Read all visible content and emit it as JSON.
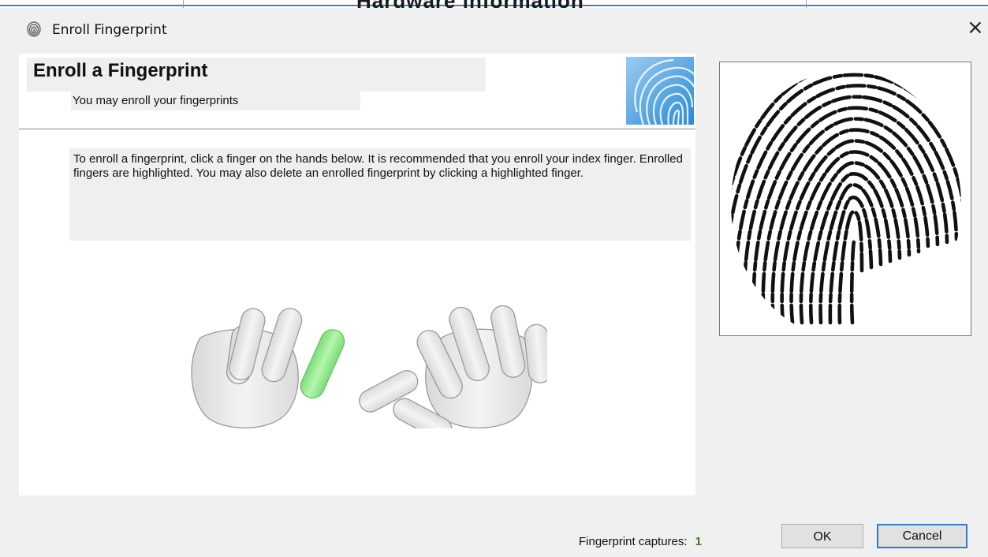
{
  "window": {
    "title": "Enroll Fingerprint",
    "behind_text": "Hardware information",
    "close_glyph": "×",
    "icons": {
      "app": "fingerprint-icon",
      "close": "close-icon"
    }
  },
  "header": {
    "title": "Enroll a Fingerprint",
    "subtitle": "You may enroll your fingerprints",
    "image": "fingerprint-banner-image"
  },
  "instructions": "To enroll a fingerprint, click a finger on the hands below.  It is recommended that you enroll your index finger.  Enrolled fingers are highlighted. You may also delete an enrolled fingerprint by clicking a highlighted finger.",
  "hands": {
    "left": [
      {
        "finger": "pinky",
        "enrolled": false
      },
      {
        "finger": "ring",
        "enrolled": false
      },
      {
        "finger": "middle",
        "enrolled": false
      },
      {
        "finger": "index",
        "enrolled": true
      },
      {
        "finger": "thumb",
        "enrolled": false
      }
    ],
    "right": [
      {
        "finger": "thumb",
        "enrolled": false
      },
      {
        "finger": "index",
        "enrolled": false
      },
      {
        "finger": "middle",
        "enrolled": false
      },
      {
        "finger": "ring",
        "enrolled": false
      },
      {
        "finger": "pinky",
        "enrolled": false
      }
    ],
    "colors": {
      "finger": "#e6e6e6",
      "enrolled": "#8fea8a",
      "outline": "#9a9a9a"
    }
  },
  "preview": {
    "image": "fingerprint-scan-image"
  },
  "footer": {
    "captures_label": "Fingerprint captures:",
    "captures_count": "1",
    "ok_label": "OK",
    "cancel_label": "Cancel"
  },
  "colors": {
    "accent": "#2f78d6",
    "count": "#3f7a1f"
  }
}
